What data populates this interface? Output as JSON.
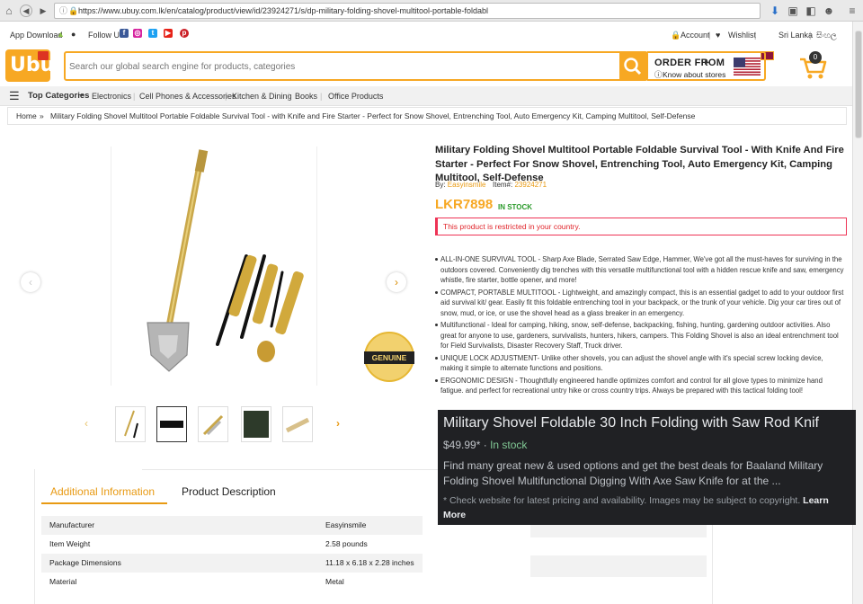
{
  "browser": {
    "url": "https://www.ubuy.com.lk/en/catalog/product/view/id/23924271/s/dp-military-folding-shovel-multitool-portable-foldabl"
  },
  "util": {
    "app_download": "App Download",
    "follow_us": "Follow Us",
    "account": "Account",
    "wishlist": "Wishlist",
    "country": "Sri Lanka",
    "lang": "සිංහල"
  },
  "header": {
    "logo": "Ubuy",
    "search_placeholder": "Search our global search engine for products, categories",
    "order_from": "ORDER FROM",
    "know_stores": "Know about stores",
    "cart_count": "0"
  },
  "categories": {
    "top": "Top Categories",
    "items": [
      "Electronics",
      "Cell Phones & Accessories",
      "Kitchen & Dining",
      "Books",
      "Office Products"
    ]
  },
  "breadcrumb": {
    "home": "Home",
    "current": "Military Folding Shovel Multitool Portable Foldable Survival Tool - with Knife and Fire Starter - Perfect for Snow Shovel, Entrenching Tool, Auto Emergency Kit, Camping Multitool, Self-Defense"
  },
  "product": {
    "title": "Military Folding Shovel Multitool Portable Foldable Survival Tool - With Knife And Fire Starter - Perfect For Snow Shovel, Entrenching Tool, Auto Emergency Kit, Camping Multitool, Self-Defense",
    "by_label": "By:",
    "brand": "Easyinsmile",
    "item_label": "Item#:",
    "item_no": "23924271",
    "price": "LKR7898",
    "stock": "IN STOCK",
    "restricted": "This product is restricted in your country.",
    "badge": "GENUINE",
    "bullets": [
      "ALL-IN-ONE SURVIVAL TOOL - Sharp Axe Blade, Serrated Saw Edge, Hammer, We've got all the must-haves for surviving in the outdoors covered. Conveniently dig trenches with this versatile multifunctional tool with a hidden rescue knife and saw, emergency whistle, fire starter, bottle opener, and more!",
      "COMPACT, PORTABLE MULTITOOL - Lightweight, and amazingly compact, this is an essential gadget to add to your outdoor first aid survival kit/ gear. Easily fit this foldable entrenching tool in your backpack, or the trunk of your vehicle. Dig your car tires out of snow, mud, or ice, or use the shovel head as a glass breaker in an emergency.",
      "Multifunctional - Ideal for camping, hiking, snow, self-defense, backpacking, fishing, hunting, gardening outdoor activities. Also great for anyone to use, gardeners, survivalists, hunters, hikers, campers. This Folding Shovel is also an ideal entrenchment tool for Field Survivalists, Disaster Recovery Staff, Truck driver.",
      "UNIQUE LOCK ADJUSTMENT- Unlike other shovels, you can adjust the shovel angle with it's special screw locking device, making it simple to alternate functions and positions.",
      "ERGONOMIC DESIGN - Thoughtfully engineered handle optimizes comfort and control for all glove types to minimize hand fatigue. and perfect for recreational untry hike or cross country trips. Always be prepared with this tactical folding tool!"
    ]
  },
  "tabs": {
    "info": "Additional Information",
    "desc": "Product Description"
  },
  "specs": [
    {
      "k": "Manufacturer",
      "v": "Easyinsmile"
    },
    {
      "k": "Item Weight",
      "v": "2.58 pounds"
    },
    {
      "k": "Package Dimensions",
      "v": "11.18 x 6.18 x 2.28 inches"
    },
    {
      "k": "Material",
      "v": "Metal"
    }
  ],
  "overlay": {
    "title": "Military Shovel Foldable 30 Inch Folding with Saw Rod Knif",
    "price": "$49.99*",
    "sep": "·",
    "stock": "In stock",
    "desc": "Find many great new & used options and get the best deals for Baaland Military Folding Shovel Multifunctional Digging With Axe Saw Knife for at the ...",
    "note": "* Check website for latest pricing and availability. Images may be subject to copyright.",
    "learn": "Learn More"
  },
  "colors": {
    "brand": "#f7a823",
    "instock": "#2b9a2b",
    "restricted": "#e0242a"
  }
}
